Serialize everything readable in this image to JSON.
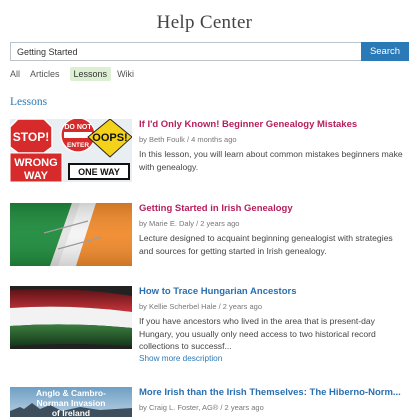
{
  "page_title": "Help Center",
  "search": {
    "value": "Getting Started",
    "button_label": "Search"
  },
  "tabs": [
    {
      "label": "All",
      "active": false
    },
    {
      "label": "Articles",
      "active": false
    },
    {
      "label": "Lessons",
      "active": true
    },
    {
      "label": "Wiki",
      "active": false
    }
  ],
  "section_heading": "Lessons",
  "lessons": [
    {
      "title": "If I'd Only Known! Beginner Genealogy Mistakes",
      "meta": "by Beth Foulk / 4 months ago",
      "desc_lines": [
        "In this lesson, you will learn about common mistakes beginners make",
        "with genealogy."
      ],
      "thumb_text": [
        "STOP!",
        "DO NOT",
        "ENTER",
        "OOPS!",
        "WRONG",
        "WAY",
        "ONE WAY"
      ],
      "thumb_icon": "road-signs-thumbnail"
    },
    {
      "title": "Getting Started in Irish Genealogy",
      "meta": "by Marie E. Daly / 2 years ago",
      "desc_lines": [
        "Lecture designed to acquaint beginning genealogist with strategies",
        "and sources for getting started in Irish genealogy."
      ],
      "thumb_icon": "irish-flag-thumbnail",
      "colors": {
        "green": "#1e8a3c",
        "white": "#f4f4f4",
        "orange": "#f08a2c"
      }
    },
    {
      "title": "How to Trace Hungarian Ancestors",
      "meta": "by Kellie Scherbel Hale / 2 years ago",
      "desc_lines": [
        "If you have ancestors who lived in the area that is present-day",
        "Hungary, you usually only need access to two historical record",
        "collections to successf..."
      ],
      "more_label": "Show more description",
      "thumb_icon": "hungarian-flag-thumbnail",
      "colors": {
        "red": "#c8343a",
        "white": "#f2f2f2",
        "green": "#3b7d3f"
      }
    },
    {
      "title": "More Irish than the Irish Themselves: The Hiberno-Norm...",
      "meta": "by Craig L. Foster, AG® / 2 years ago",
      "thumb_text": [
        "Anglo & Cambro-",
        "Norman Invasion",
        "of Ireland"
      ],
      "thumb_icon": "norman-invasion-thumbnail"
    }
  ]
}
